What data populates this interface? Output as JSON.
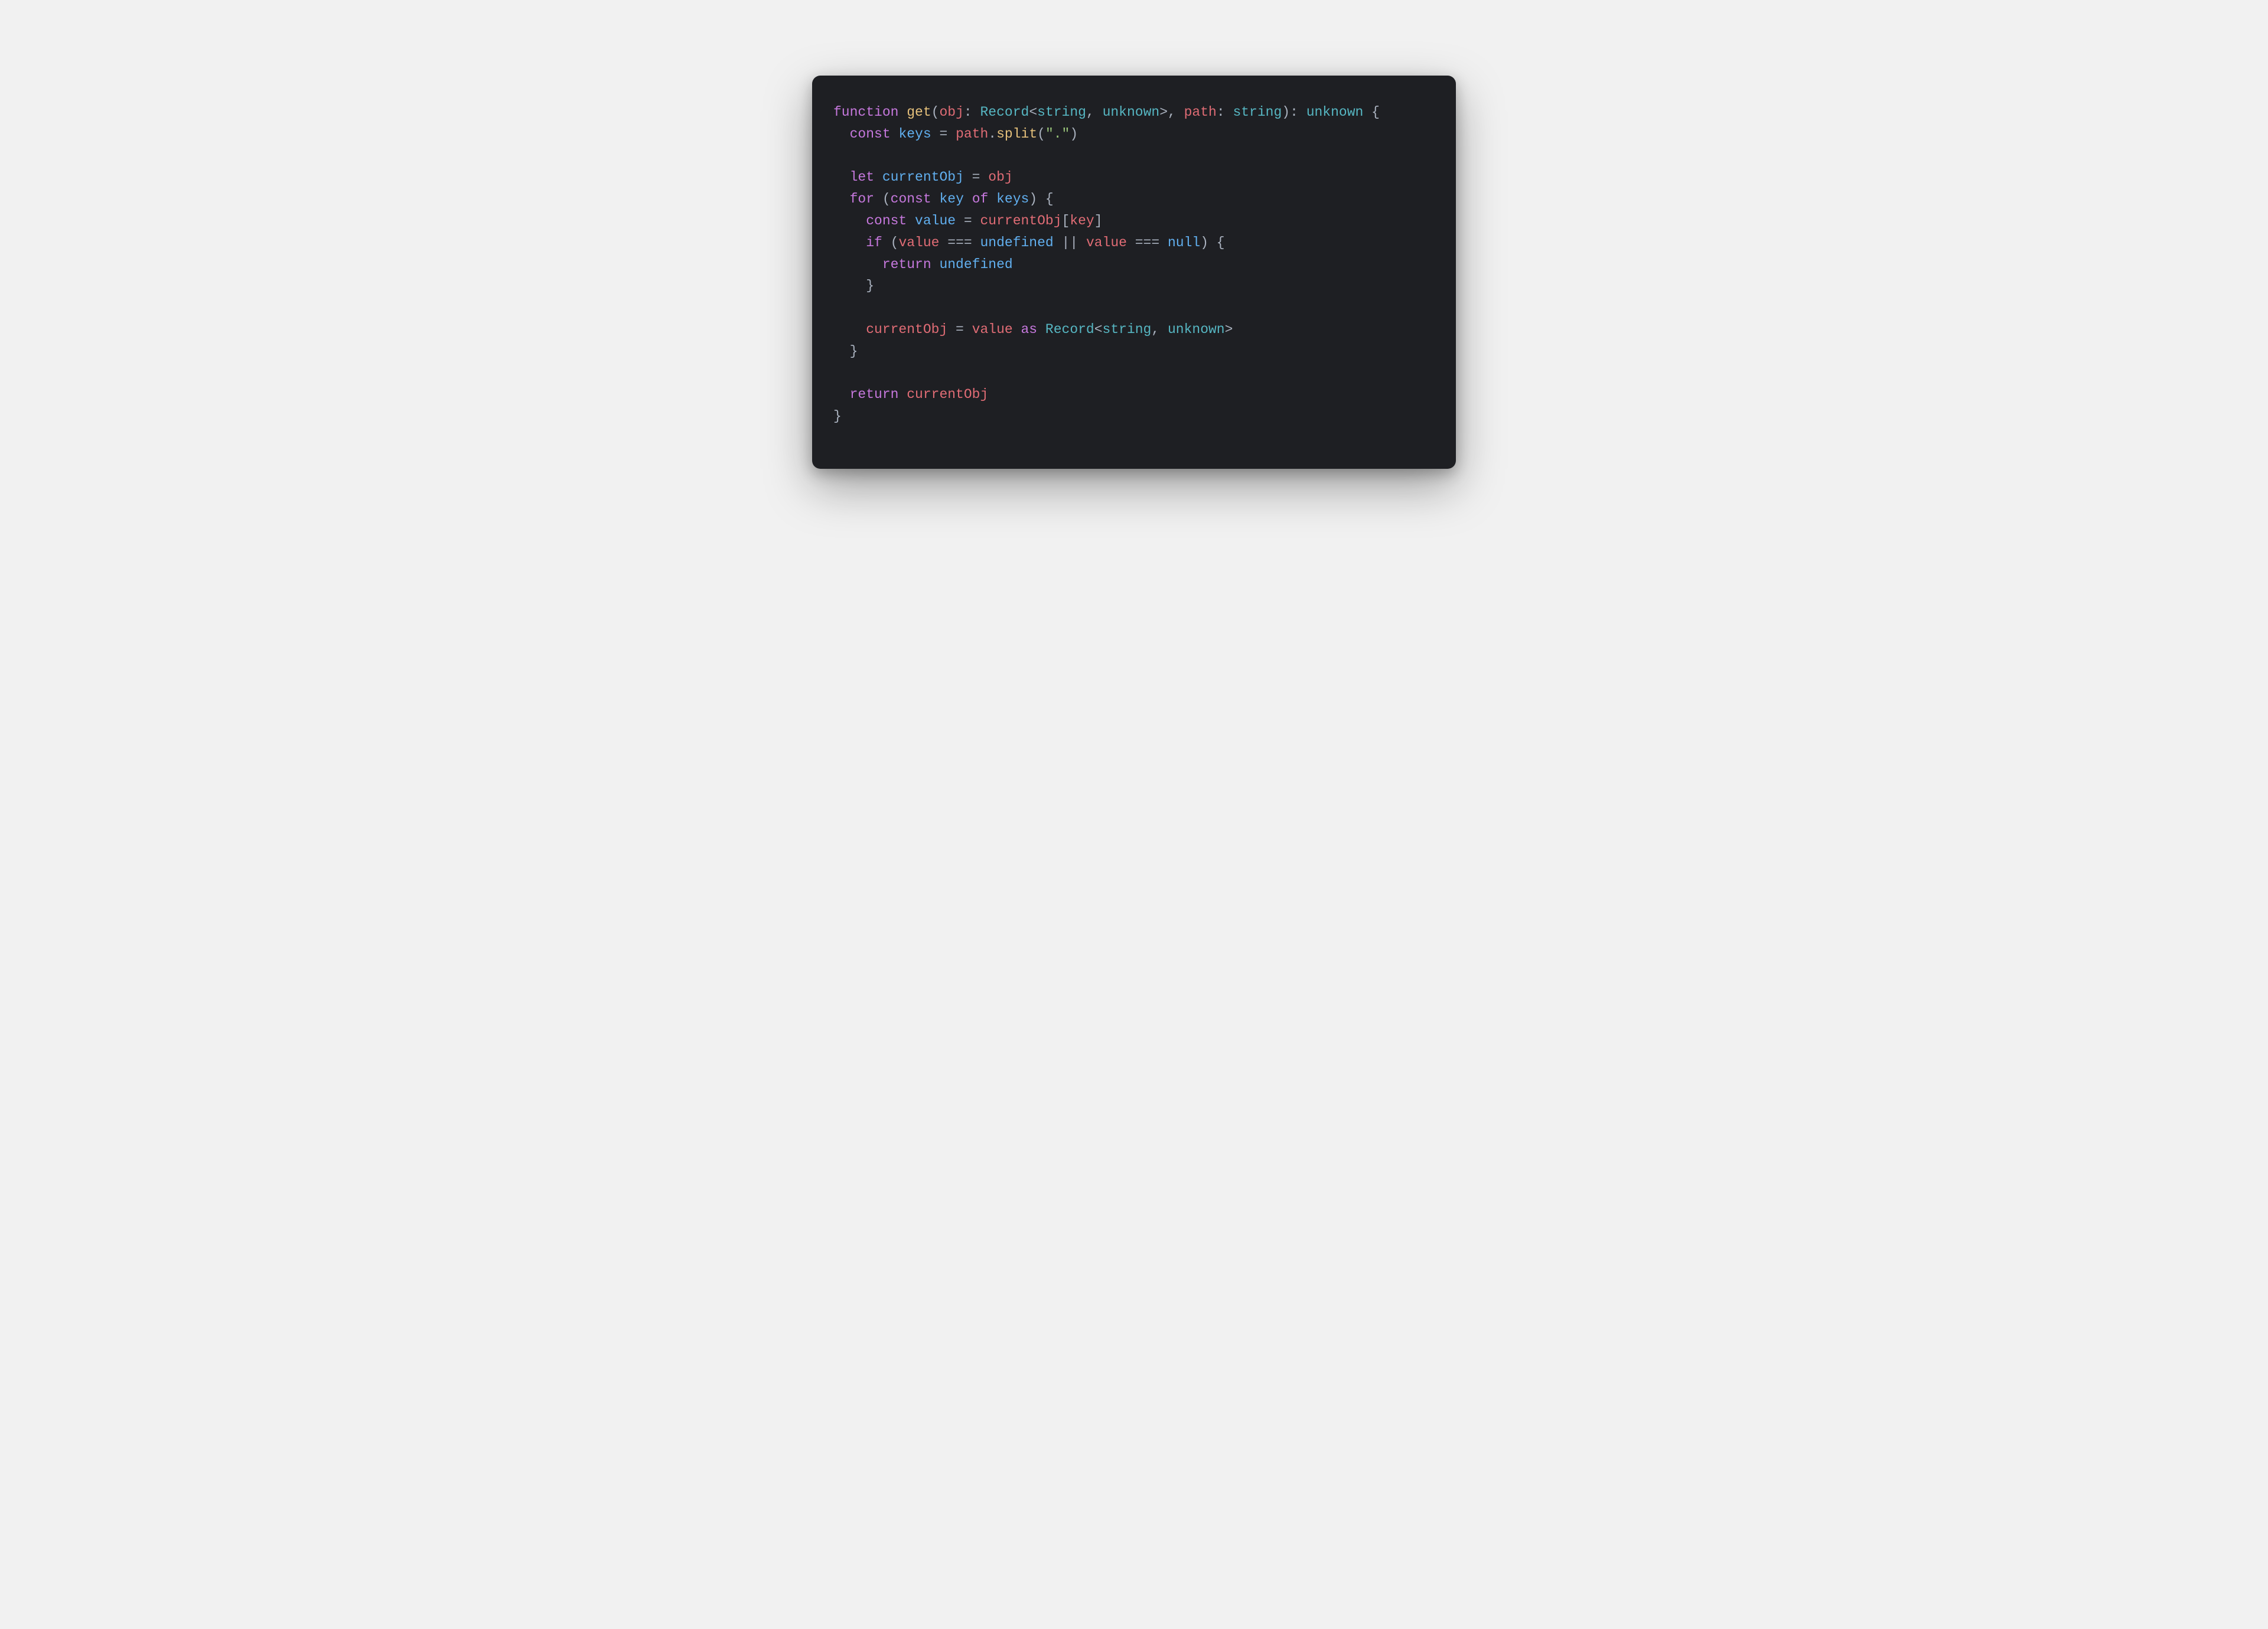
{
  "colors": {
    "page_bg": "#f1f1f1",
    "code_bg": "#1e1f23",
    "default_text": "#aab2bf",
    "keyword": "#c678dd",
    "function_name": "#e5c07b",
    "identifier": "#e06c75",
    "variable": "#61afef",
    "type": "#56b6c2",
    "string": "#98c379",
    "punctuation": "#aab2bf"
  },
  "code": {
    "language": "typescript",
    "plain": "function get(obj: Record<string, unknown>, path: string): unknown {\n  const keys = path.split(\".\")\n\n  let currentObj = obj\n  for (const key of keys) {\n    const value = currentObj[key]\n    if (value === undefined || value === null) {\n      return undefined\n    }\n\n    currentObj = value as Record<string, unknown>\n  }\n\n  return currentObj\n}",
    "lines": [
      [
        {
          "t": "function ",
          "c": "kw"
        },
        {
          "t": "get",
          "c": "fn"
        },
        {
          "t": "(",
          "c": "pn"
        },
        {
          "t": "obj",
          "c": "id"
        },
        {
          "t": ": ",
          "c": "pn"
        },
        {
          "t": "Record",
          "c": "ty"
        },
        {
          "t": "<",
          "c": "pn"
        },
        {
          "t": "string",
          "c": "ty"
        },
        {
          "t": ", ",
          "c": "pn"
        },
        {
          "t": "unknown",
          "c": "ty"
        },
        {
          "t": ">, ",
          "c": "pn"
        },
        {
          "t": "path",
          "c": "id"
        },
        {
          "t": ": ",
          "c": "pn"
        },
        {
          "t": "string",
          "c": "ty"
        },
        {
          "t": "): ",
          "c": "pn"
        },
        {
          "t": "unknown",
          "c": "ty"
        },
        {
          "t": " {",
          "c": "pn"
        }
      ],
      [
        {
          "t": "  ",
          "c": "pn"
        },
        {
          "t": "const ",
          "c": "kw"
        },
        {
          "t": "keys",
          "c": "vr"
        },
        {
          "t": " = ",
          "c": "pn"
        },
        {
          "t": "path",
          "c": "id"
        },
        {
          "t": ".",
          "c": "pn"
        },
        {
          "t": "split",
          "c": "fn"
        },
        {
          "t": "(",
          "c": "pn"
        },
        {
          "t": "\".\"",
          "c": "st"
        },
        {
          "t": ")",
          "c": "pn"
        }
      ],
      [],
      [
        {
          "t": "  ",
          "c": "pn"
        },
        {
          "t": "let ",
          "c": "kw"
        },
        {
          "t": "currentObj",
          "c": "vr"
        },
        {
          "t": " = ",
          "c": "pn"
        },
        {
          "t": "obj",
          "c": "id"
        }
      ],
      [
        {
          "t": "  ",
          "c": "pn"
        },
        {
          "t": "for ",
          "c": "kw"
        },
        {
          "t": "(",
          "c": "pn"
        },
        {
          "t": "const ",
          "c": "kw"
        },
        {
          "t": "key",
          "c": "vr"
        },
        {
          "t": " of ",
          "c": "kw"
        },
        {
          "t": "keys",
          "c": "vr"
        },
        {
          "t": ") {",
          "c": "pn"
        }
      ],
      [
        {
          "t": "    ",
          "c": "pn"
        },
        {
          "t": "const ",
          "c": "kw"
        },
        {
          "t": "value",
          "c": "vr"
        },
        {
          "t": " = ",
          "c": "pn"
        },
        {
          "t": "currentObj",
          "c": "id"
        },
        {
          "t": "[",
          "c": "pn"
        },
        {
          "t": "key",
          "c": "id"
        },
        {
          "t": "]",
          "c": "pn"
        }
      ],
      [
        {
          "t": "    ",
          "c": "pn"
        },
        {
          "t": "if ",
          "c": "kw"
        },
        {
          "t": "(",
          "c": "pn"
        },
        {
          "t": "value",
          "c": "id"
        },
        {
          "t": " === ",
          "c": "pn"
        },
        {
          "t": "undefined",
          "c": "vr"
        },
        {
          "t": " || ",
          "c": "pn"
        },
        {
          "t": "value",
          "c": "id"
        },
        {
          "t": " === ",
          "c": "pn"
        },
        {
          "t": "null",
          "c": "vr"
        },
        {
          "t": ") {",
          "c": "pn"
        }
      ],
      [
        {
          "t": "      ",
          "c": "pn"
        },
        {
          "t": "return ",
          "c": "kw"
        },
        {
          "t": "undefined",
          "c": "vr"
        }
      ],
      [
        {
          "t": "    }",
          "c": "pn"
        }
      ],
      [],
      [
        {
          "t": "    ",
          "c": "pn"
        },
        {
          "t": "currentObj",
          "c": "id"
        },
        {
          "t": " = ",
          "c": "pn"
        },
        {
          "t": "value",
          "c": "id"
        },
        {
          "t": " as ",
          "c": "kw"
        },
        {
          "t": "Record",
          "c": "ty"
        },
        {
          "t": "<",
          "c": "pn"
        },
        {
          "t": "string",
          "c": "ty"
        },
        {
          "t": ", ",
          "c": "pn"
        },
        {
          "t": "unknown",
          "c": "ty"
        },
        {
          "t": ">",
          "c": "pn"
        }
      ],
      [
        {
          "t": "  }",
          "c": "pn"
        }
      ],
      [],
      [
        {
          "t": "  ",
          "c": "pn"
        },
        {
          "t": "return ",
          "c": "kw"
        },
        {
          "t": "currentObj",
          "c": "id"
        }
      ],
      [
        {
          "t": "}",
          "c": "pn"
        }
      ]
    ]
  }
}
